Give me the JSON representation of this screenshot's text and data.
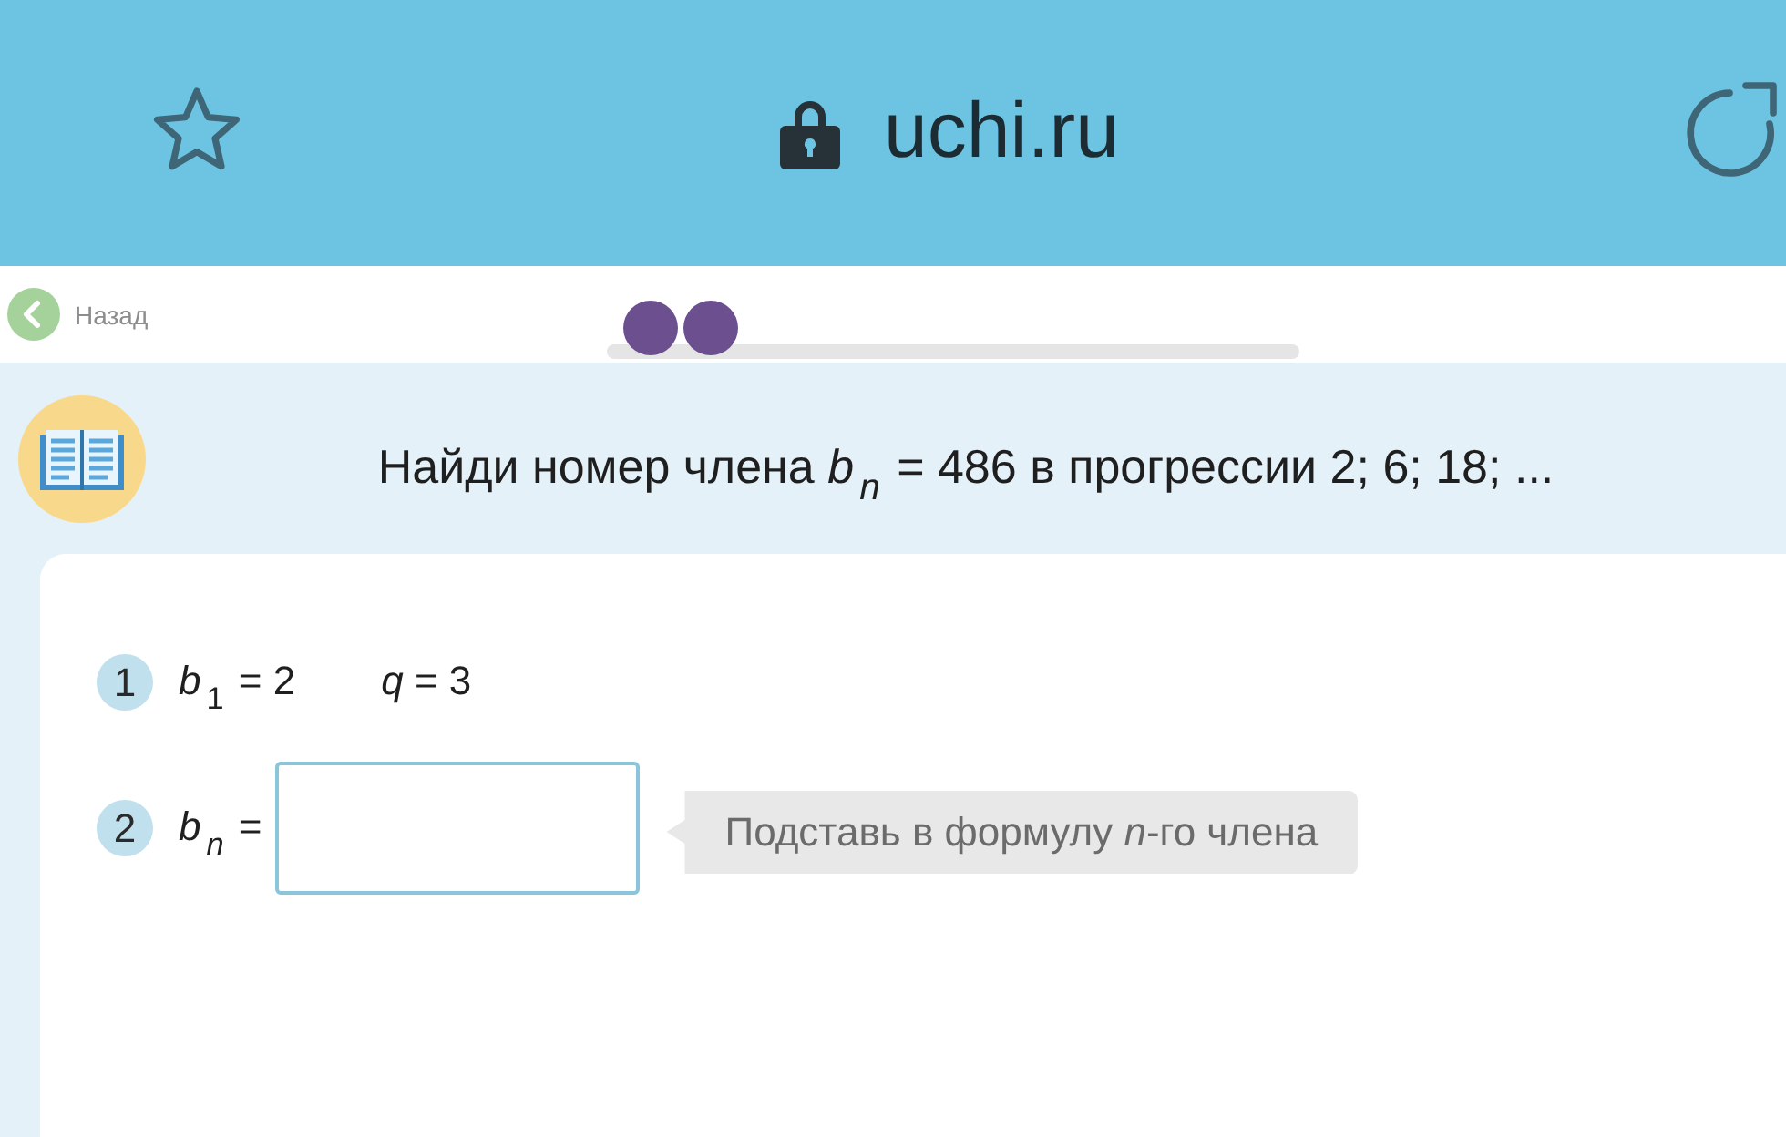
{
  "browser_bar": {
    "url": "uchi.ru"
  },
  "nav": {
    "back_label": "Назад",
    "progress_steps": [
      {
        "color": "#6c4f8f"
      },
      {
        "color": "#6c4f8f"
      }
    ]
  },
  "task": {
    "question": "Найди номер члена *b*$_{n}$ = 486 в прогрессии 2; 6; 18; ..."
  },
  "steps": [
    {
      "number": "1",
      "kind": "given",
      "parts": [
        "*b*$_{1}$ = 2",
        "*q* = 3"
      ]
    },
    {
      "number": "2",
      "kind": "answer",
      "label": "*b*$_{n}$ =",
      "hint": "Подставь в формулу *n*-го члена"
    }
  ]
}
